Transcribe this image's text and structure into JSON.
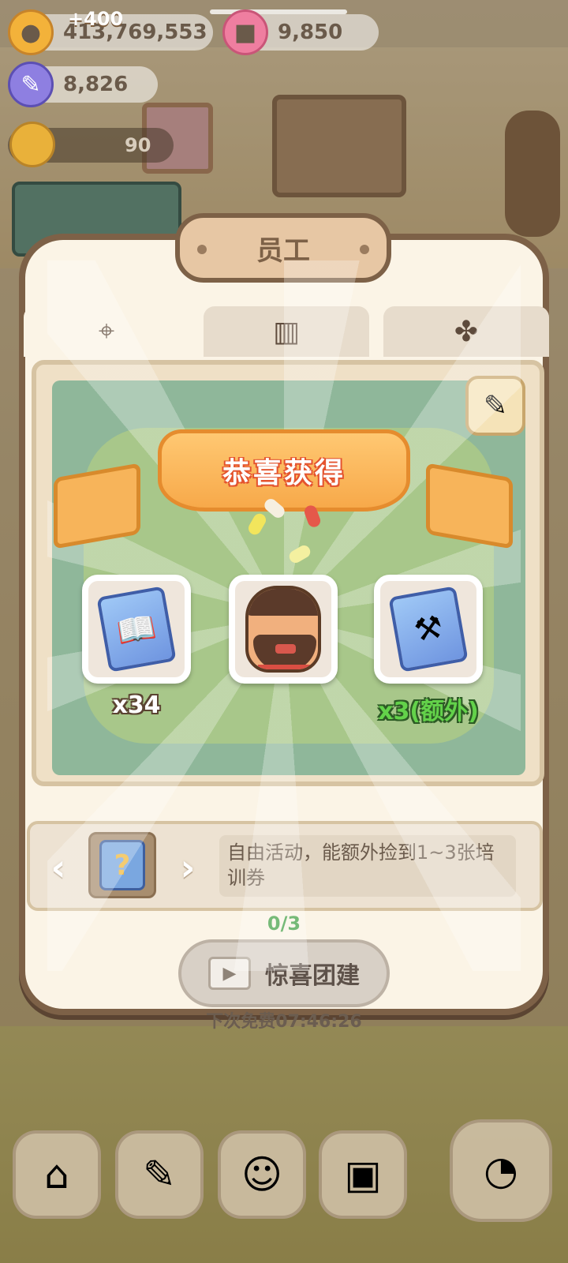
{
  "resources": {
    "coins": "413,769,553",
    "coins_gain": "+400",
    "gems": "9,850",
    "feathers": "8,826",
    "level": "90"
  },
  "panel": {
    "title": "员工",
    "tabs": [
      {
        "icon": "map-pin-icon",
        "active": true
      },
      {
        "icon": "book-icon",
        "active": false
      },
      {
        "icon": "clover-icon",
        "active": false
      }
    ],
    "description": "自由活动，能额外捡到1~3张培训券",
    "progress": "0/3",
    "team_button": "惊喜团建",
    "next_free": "下次免费07:46:26"
  },
  "reward_popup": {
    "banner": "恭喜获得",
    "items": [
      {
        "icon": "training-book-card-icon",
        "label": "x34"
      },
      {
        "icon": "staff-bearded-man-icon",
        "label": ""
      },
      {
        "icon": "training-tool-card-icon",
        "label": "x3(额外)"
      }
    ]
  },
  "bottom_nav": [
    {
      "icon": "mushroom-house-icon"
    },
    {
      "icon": "notebook-icon"
    },
    {
      "icon": "staff-avatar-icon"
    },
    {
      "icon": "shop-bag-icon"
    },
    {
      "icon": "character-clock-icon"
    }
  ],
  "colors": {
    "panel_border": "#7d6147",
    "ribbon": "#f7a94a",
    "extra_label": "#63d24a",
    "progress": "#41a044"
  }
}
